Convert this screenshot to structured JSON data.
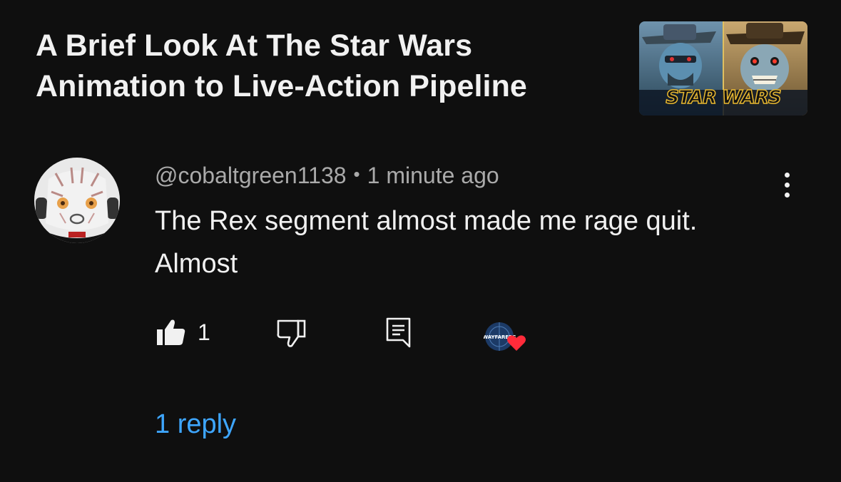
{
  "video": {
    "title": "A Brief Look At The Star Wars Animation to Live-Action Pipeline",
    "thumbnail_logo_text": "STAR WARS"
  },
  "comment": {
    "author": "@cobaltgreen1138",
    "separator": "•",
    "time": "1 minute ago",
    "text": "The Rex segment almost made me rage quit. Almost",
    "like_count": "1",
    "creator_avatar_text": "WAYFARERS",
    "replies_label": "1 reply"
  },
  "icons": {
    "menu": "more-vertical-icon",
    "like": "thumbs-up-filled-icon",
    "dislike": "thumbs-down-outline-icon",
    "reply": "comment-reply-icon",
    "heart": "heart-icon"
  },
  "colors": {
    "background": "#0f0f0f",
    "text_primary": "#f1f1f1",
    "text_secondary": "#aaaaaa",
    "link": "#3ea6ff",
    "heart": "#ff2b3a"
  }
}
